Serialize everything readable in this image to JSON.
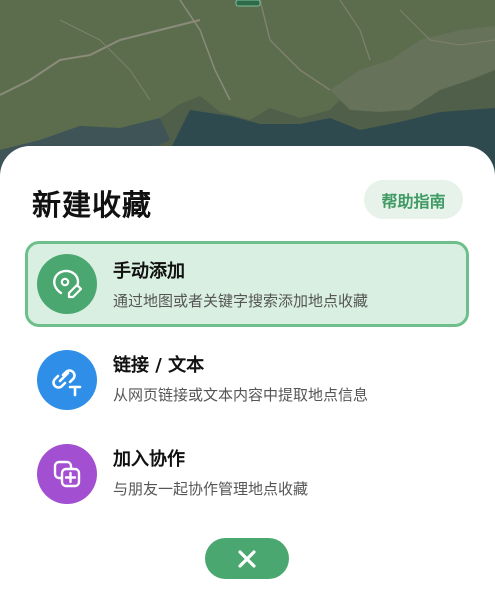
{
  "sheet": {
    "title": "新建收藏",
    "help_label": "帮助指南"
  },
  "options": [
    {
      "label": "手动添加",
      "desc": "通过地图或者关键字搜索添加地点收藏",
      "icon": "map-pin-edit-icon",
      "color": "#4aa76f",
      "selected": true
    },
    {
      "label": "链接 / 文本",
      "desc": "从网页链接或文本内容中提取地点信息",
      "icon": "link-text-icon",
      "color": "#2f8fe8",
      "selected": false
    },
    {
      "label": "加入协作",
      "desc": "与朋友一起协作管理地点收藏",
      "icon": "collaborate-icon",
      "color": "#a24fd1",
      "selected": false
    }
  ],
  "close_icon": "close-icon",
  "colors": {
    "accent": "#4aa76f",
    "selected_bg": "#d9efe1",
    "selected_border": "#6fbf8c"
  }
}
